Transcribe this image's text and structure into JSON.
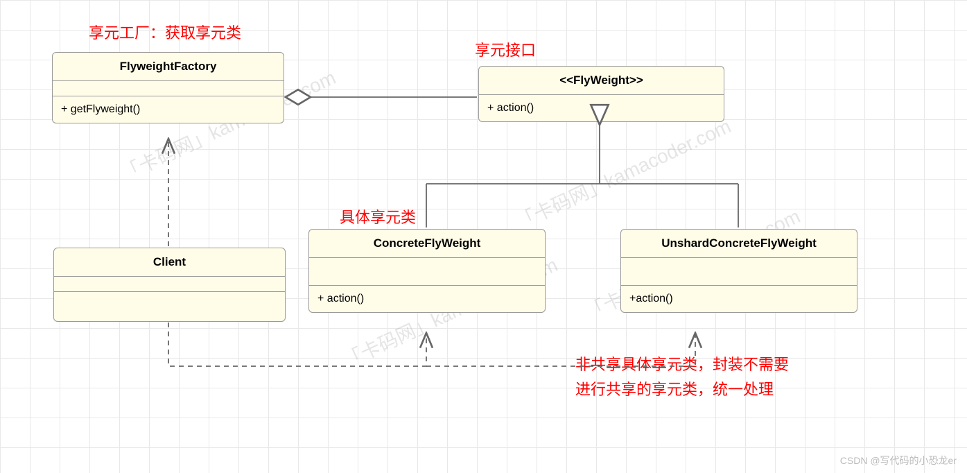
{
  "annotations": {
    "factory_label": "享元工厂：获取享元类",
    "interface_label": "享元接口",
    "concrete_label": "具体享元类",
    "unshared_label_line1": "非共享具体享元类，封装不需要",
    "unshared_label_line2": "进行共享的享元类，统一处理"
  },
  "classes": {
    "factory": {
      "name": "FlyweightFactory",
      "op": "+ getFlyweight()"
    },
    "flyweight": {
      "name": "<<FlyWeight>>",
      "op": "+ action()"
    },
    "client": {
      "name": "Client"
    },
    "concrete": {
      "name": "ConcreteFlyWeight",
      "op": "+ action()"
    },
    "unshared": {
      "name": "UnshardConcreteFlyWeight",
      "op": "+action()"
    }
  },
  "watermark_diag": "「卡码网」kamacoder.com",
  "watermark_credit": "CSDN @写代码的小恐龙er"
}
